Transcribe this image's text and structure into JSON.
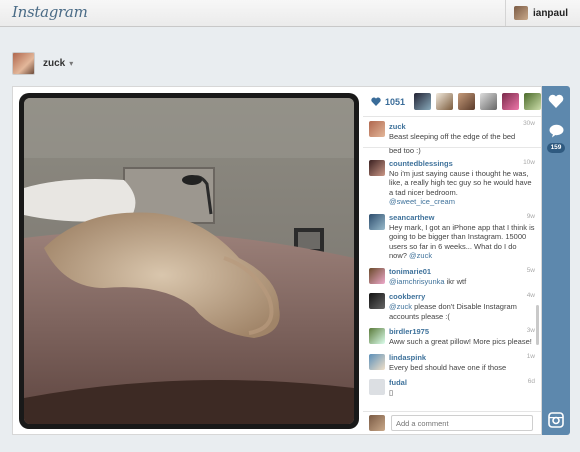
{
  "topbar": {
    "logo": "Instagram",
    "username": "ianpaul"
  },
  "owner": {
    "username": "zuck"
  },
  "post": {
    "likes": "1051",
    "comment_count": "159",
    "caption": {
      "user": "zuck",
      "text": "Beast sleeping off the edge of the bed",
      "time": "30w"
    },
    "clipped_text": "bed too :)",
    "comments": [
      {
        "user": "countedblessings",
        "text": "No i'm just saying cause i thought he was, like, a really high tec guy so he would have a tad nicer bedroom.",
        "mention": "@sweet_ice_cream",
        "time": "10w"
      },
      {
        "user": "seancarthew",
        "text": "Hey mark, I got an iPhone app that I think is going to be bigger than Instagram. 15000 users so far in 6 weeks... What do I do now?",
        "mention": "@zuck",
        "time": "9w"
      },
      {
        "user": "tonimarie01",
        "text": "ikr wtf",
        "mention": "@iamchrisyunka",
        "time": "5w"
      },
      {
        "user": "cookberry",
        "text": "please don't Disable Instagram accounts please :(",
        "mention": "@zuck",
        "time": "4w"
      },
      {
        "user": "birdler1975",
        "text": "Aww such a great pillow! More pics please!",
        "mention": "",
        "time": "3w"
      },
      {
        "user": "lindaspink",
        "text": "Every bed should have one if those",
        "mention": "",
        "time": "1w"
      },
      {
        "user": "fudal",
        "text": "▯",
        "mention": "",
        "time": "6d"
      }
    ],
    "add_comment_placeholder": "Add a comment"
  },
  "icons": [
    "heart-icon",
    "comment-icon",
    "instagram-icon"
  ],
  "colors": {
    "accent": "#3f729b",
    "rail": "#5d88ad"
  }
}
